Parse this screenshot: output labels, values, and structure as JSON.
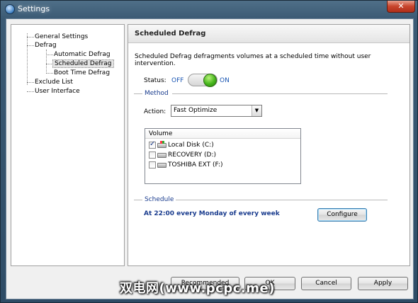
{
  "window": {
    "title": "Settings",
    "close_label": "✕"
  },
  "nav": {
    "items": [
      {
        "label": "General Settings"
      },
      {
        "label": "Defrag"
      },
      {
        "label": "Automatic Defrag"
      },
      {
        "label": "Scheduled Defrag",
        "selected": true
      },
      {
        "label": "Boot Time Defrag"
      },
      {
        "label": "Exclude List"
      },
      {
        "label": "User Interface"
      }
    ]
  },
  "panel": {
    "title": "Scheduled Defrag",
    "description": "Scheduled Defrag defragments volumes at a scheduled time without user intervention.",
    "status": {
      "label": "Status:",
      "off": "OFF",
      "on": "ON",
      "value": "on"
    },
    "method_label": "Method",
    "action": {
      "label": "Action:",
      "value": "Fast Optimize"
    },
    "volume": {
      "header": "Volume",
      "rows": [
        {
          "label": "Local Disk (C:)",
          "checked": true,
          "icon": "windows-drive-icon"
        },
        {
          "label": "RECOVERY (D:)",
          "checked": false,
          "icon": "drive-icon"
        },
        {
          "label": "TOSHIBA EXT (F:)",
          "checked": false,
          "icon": "drive-icon"
        }
      ]
    },
    "schedule_label": "Schedule",
    "schedule_text": "At 22:00 every Monday of every week",
    "configure_label": "Configure"
  },
  "footer": {
    "recommended_label": "Recommended",
    "ok_label": "OK",
    "cancel_label": "Cancel",
    "apply_label": "Apply"
  },
  "watermark": "双电网(www.pcpc.me)",
  "colors": {
    "accent_blue": "#1a3c8e",
    "toggle_green": "#46b61c"
  }
}
